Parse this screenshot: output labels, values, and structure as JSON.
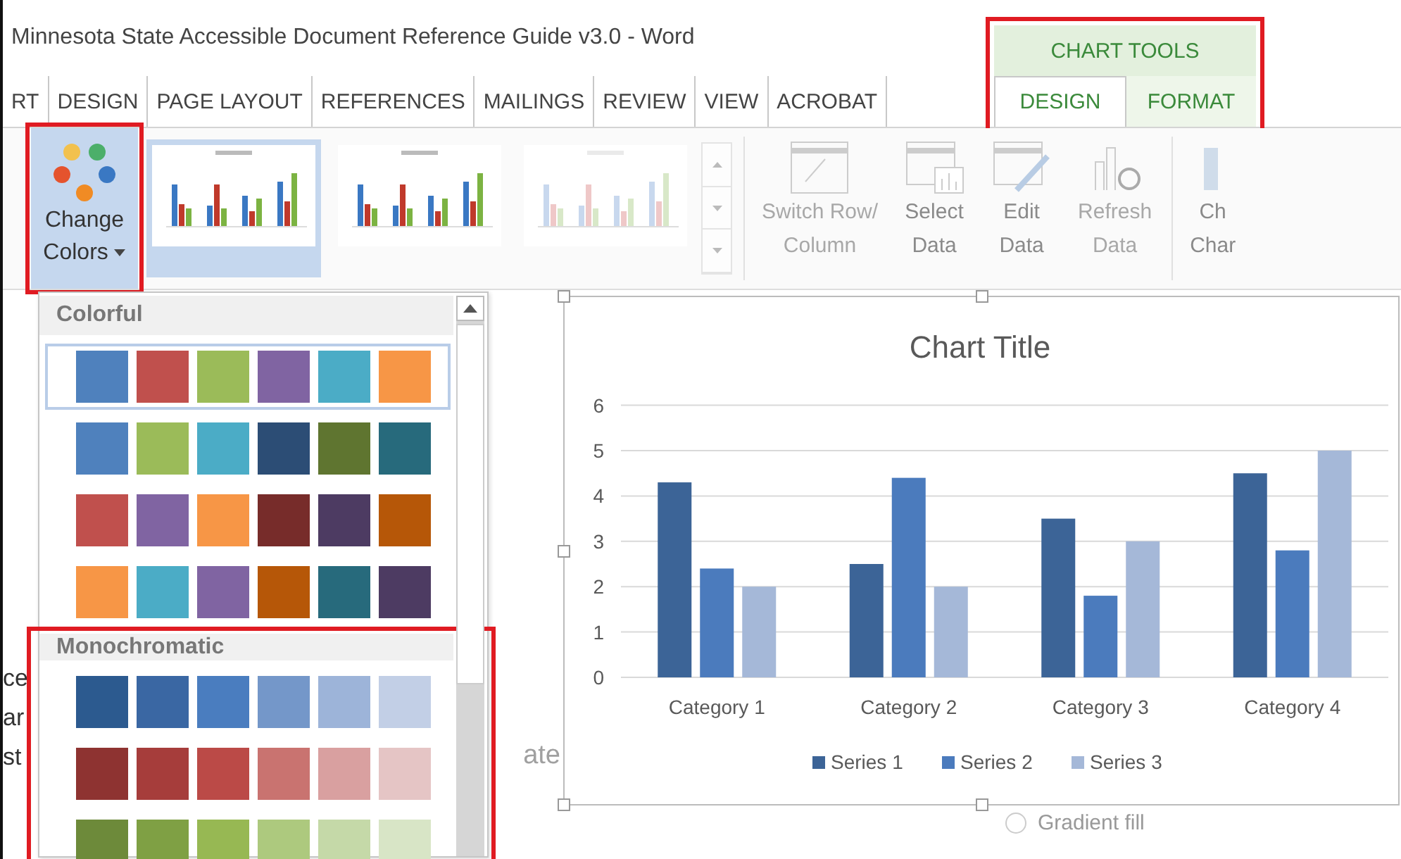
{
  "window": {
    "title": "Minnesota State Accessible Document Reference Guide v3.0 - Word"
  },
  "ribbon_tabs": [
    {
      "label": "RT",
      "selected": false
    },
    {
      "label": "DESIGN",
      "selected": false
    },
    {
      "label": "PAGE LAYOUT",
      "selected": false
    },
    {
      "label": "REFERENCES",
      "selected": false
    },
    {
      "label": "MAILINGS",
      "selected": false
    },
    {
      "label": "REVIEW",
      "selected": false
    },
    {
      "label": "VIEW",
      "selected": false
    },
    {
      "label": "ACROBAT",
      "selected": false
    }
  ],
  "chart_tools": {
    "label": "CHART TOOLS",
    "highlighted": true,
    "tabs": [
      {
        "label": "DESIGN",
        "selected": true
      },
      {
        "label": "FORMAT",
        "selected": false
      }
    ]
  },
  "ribbon": {
    "change_colors": {
      "label": "Change Colors",
      "highlighted": true
    },
    "chart_styles": [
      {
        "selected": true
      },
      {
        "selected": false
      },
      {
        "selected": false
      }
    ],
    "data_buttons": [
      {
        "lines": [
          "Switch Row/",
          "Column"
        ],
        "disabled": true,
        "kind": "switch"
      },
      {
        "lines": [
          "Select",
          "Data"
        ],
        "disabled": false,
        "kind": "select"
      },
      {
        "lines": [
          "Edit",
          "Data"
        ],
        "disabled": false,
        "kind": "edit"
      },
      {
        "lines": [
          "Refresh",
          "Data"
        ],
        "disabled": true,
        "kind": "refresh"
      },
      {
        "lines": [
          "Ch",
          "Char"
        ],
        "disabled": false,
        "kind": "type"
      }
    ]
  },
  "color_menu": {
    "palettes": [
      {
        "title": "Colorful",
        "highlighted": false,
        "rows": [
          {
            "selected": true,
            "swatches": [
              {
                "color": "#4f81bd"
              },
              {
                "color": "#c0504d"
              },
              {
                "color": "#9bbb59"
              },
              {
                "color": "#8064a2"
              },
              {
                "color": "#4bacc6"
              },
              {
                "color": "#f79646"
              }
            ]
          },
          {
            "selected": false,
            "swatches": [
              {
                "color": "#4f81bd"
              },
              {
                "color": "#9bbb59"
              },
              {
                "color": "#4bacc6"
              },
              {
                "color": "#2c4d75"
              },
              {
                "color": "#5f7530"
              },
              {
                "color": "#276a7c"
              }
            ]
          },
          {
            "selected": false,
            "swatches": [
              {
                "color": "#c0504d"
              },
              {
                "color": "#8064a2"
              },
              {
                "color": "#f79646"
              },
              {
                "color": "#772c2a"
              },
              {
                "color": "#4d3b62"
              },
              {
                "color": "#b65708"
              }
            ]
          },
          {
            "selected": false,
            "swatches": [
              {
                "color": "#f79646"
              },
              {
                "color": "#4bacc6"
              },
              {
                "color": "#8064a2"
              },
              {
                "color": "#b65708"
              },
              {
                "color": "#276a7c"
              },
              {
                "color": "#4d3b62"
              }
            ]
          }
        ]
      },
      {
        "title": "Monochromatic",
        "highlighted": true,
        "rows": [
          {
            "selected": false,
            "swatches": [
              {
                "color": "#2c5a8f"
              },
              {
                "color": "#3a67a3"
              },
              {
                "color": "#4a7dbf"
              },
              {
                "color": "#7497c9"
              },
              {
                "color": "#9db4d9"
              },
              {
                "color": "#c2cfe6"
              }
            ]
          },
          {
            "selected": false,
            "swatches": [
              {
                "color": "#8e3331"
              },
              {
                "color": "#a63d3b"
              },
              {
                "color": "#bb4a47"
              },
              {
                "color": "#c97370"
              },
              {
                "color": "#d9a0a0"
              },
              {
                "color": "#e5c5c5"
              }
            ]
          },
          {
            "selected": false,
            "swatches": [
              {
                "color": "#6d8a3a"
              },
              {
                "color": "#7fa044"
              },
              {
                "color": "#97b853"
              },
              {
                "color": "#adc97e"
              },
              {
                "color": "#c5d9a8"
              },
              {
                "color": "#d8e5c6"
              }
            ]
          }
        ]
      }
    ]
  },
  "document": {
    "fragments": [
      "ce",
      "ar",
      "st"
    ],
    "hidden_text": "ate"
  },
  "chart": {
    "chart_data": {
      "type": "bar",
      "title": "Chart Title",
      "categories": [
        "Category 1",
        "Category 2",
        "Category 3",
        "Category 4"
      ],
      "series": [
        {
          "name": "Series 1",
          "color": "#3c6497",
          "values": [
            4.3,
            2.5,
            3.5,
            4.5
          ]
        },
        {
          "name": "Series 2",
          "color": "#4b7bbd",
          "values": [
            2.4,
            4.4,
            1.8,
            2.8
          ]
        },
        {
          "name": "Series 3",
          "color": "#a5b8d8",
          "values": [
            2,
            2,
            3,
            5
          ]
        }
      ],
      "ylim": [
        0,
        6
      ],
      "yticks": [
        0,
        1,
        2,
        3,
        4,
        5,
        6
      ],
      "grid": true,
      "legend": "bottom"
    }
  },
  "format_pane": {
    "option": {
      "label": "Gradient fill",
      "selected": false
    }
  }
}
